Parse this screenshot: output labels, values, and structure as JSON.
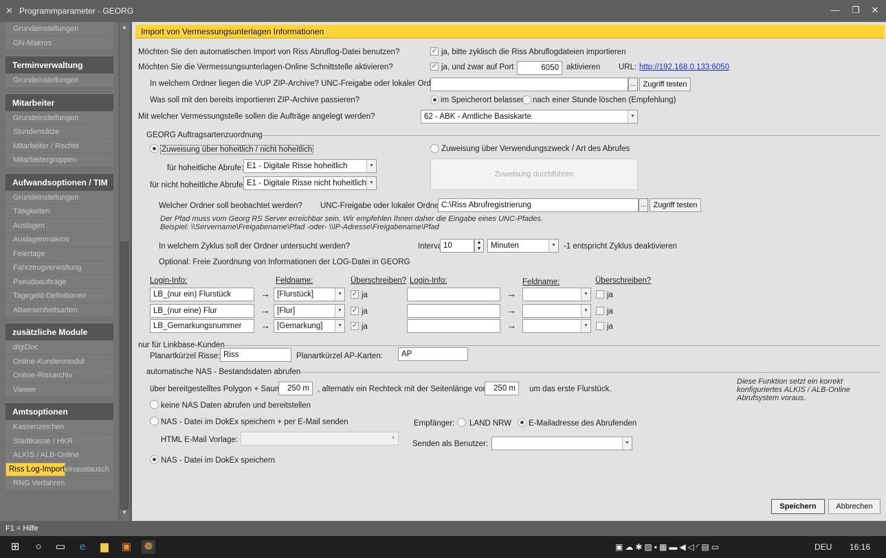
{
  "window": {
    "title": "Programmparameter -   GEORG",
    "status": "F1 = Hilfe"
  },
  "sidebar": {
    "top_items": [
      "Grundeinstellungen",
      "GN-Makros"
    ],
    "groups": [
      {
        "title": "Terminverwaltung",
        "items": [
          "Grundeinstellungen"
        ]
      },
      {
        "title": "Mitarbeiter",
        "items": [
          "Grundeinstellungen",
          "Stundensätze",
          "Mitarbeiter / Rechte",
          "Mitarbeitergruppen"
        ]
      },
      {
        "title": "Aufwandsoptionen / TIM",
        "items": [
          "Grundeinstellungen",
          "Tätigkeiten",
          "Auslagen",
          "Auslagenmakros",
          "Feiertage",
          "Fahrzeugverwaltung",
          "Pseudoaufträge",
          "Tagegeld-Definitionen",
          "Abwesenheitsarten"
        ]
      },
      {
        "title": "zusätzliche Module",
        "items": [
          "digiDoc",
          "Online-Kundenmodul",
          "Online-Rissarchiv",
          "Viewer"
        ]
      },
      {
        "title": "Amtsoptionen",
        "items": [
          "Kassenzeichen",
          "Stadtkasse / HKR",
          "ALKIS / ALB-Online",
          "Riss Log-Import",
          "ALKIS Meilensteinaustausch",
          "RNG Verfahren"
        ]
      }
    ],
    "selected": "Riss Log-Import"
  },
  "header": "Import von Vermessungsunterlagen Informationen",
  "q1": "Möchten Sie den automatischen Import von Riss Abruflog-Datei benutzen?",
  "q1_check": "ja, bitte zyklisch die Riss Abruflogdateien importieren",
  "q2": "Möchten Sie die Vermessungsunterlagen-Online Schnittstelle aktivieren?",
  "q2_check": "ja, und zwar auf Port",
  "port": "6050",
  "aktivieren": "aktivieren",
  "url_label": "URL:",
  "url": "http://192.168.0.133:6050",
  "q3": "In welchem Ordner liegen die VUP ZIP-Archive?  UNC-Freigabe oder lokaler Ordner:",
  "dots": "...",
  "test_btn": "Zugriff testen",
  "q4": "Was soll mit den bereits importieren ZIP-Archive passieren?",
  "opt_keep": "im Speicherort belassen",
  "opt_delete": "nach einer Stunde löschen (Empfehlung)",
  "q5": "Mit welcher Vermessungstelle sollen die Aufträge angelegt werden?",
  "vstelle": "62 - ABK - Amtliche Basiskarte",
  "grp_auftrag": "GEORG Auftragsartenzuordnung",
  "radio_hoheit": "Zuweisung über hoheitlich / nicht hoheitlich",
  "radio_zweck": "Zuweisung über Verwendungszweck / Art des Abrufes",
  "hoheit_label": "für hoheitliche Abrufe:",
  "hoheit_val": "E1 - Digitale Risse hoheitlich",
  "nhoheit_label": "für nicht hoheitliche Abrufe:",
  "nhoheit_val": "E1 - Digitale Risse nicht hoheitlich",
  "zuweisung_btn": "Zuweisung durchführen",
  "q6": "Welcher Ordner soll beobachtet werden?",
  "q6_unc": "UNC-Freigabe oder lokaler Ordner:",
  "folder": "C:\\Riss Abrufregistrierung",
  "hint1": "Der Pfad muss vom Georg RS Server erreichbar sein. Wir empfehlen Ihnen daher die Eingabe eines UNC-Pfades.",
  "hint2": "Beispiel: \\\\Servername\\Freigabename\\Pfad -oder- \\\\IP-Adresse\\Freigabename\\Pfad",
  "q7": "In welchem Zyklus soll der Ordner untersucht werden?",
  "intervall": "Intervall",
  "interval_val": "10",
  "unit": "Minuten",
  "cycle_note": "-1 entspricht Zyklus deaktivieren",
  "optional": "Optional: Freie Zuordnung von Informationen der LOG-Datei in GEORG",
  "col_login": "Login-Info:",
  "col_feld": "Feldname:",
  "col_over": "Überschreiben?",
  "arrow": "→",
  "ja": "ja",
  "rows": [
    {
      "login": "LB_(nur ein) Flurstück",
      "feld": "[Flurstück]"
    },
    {
      "login": "LB_(nur eine) Flur",
      "feld": "[Flur]"
    },
    {
      "login": "LB_Gemarkungsnummer",
      "feld": "[Gemarkung]"
    }
  ],
  "grp_link": "nur für Linkbase-Kunden",
  "risse_label": "Planartkürzel Risse:",
  "risse_val": "Riss",
  "ap_label": "Planartkürzel AP-Karten:",
  "ap_val": "AP",
  "grp_nas": "automatische NAS - Bestandsdaten abrufen",
  "poly_label": "über bereitgestelltes Polygon + Saum",
  "poly_val": "250 m",
  "rect_label": ", alternativ ein Rechteck mit der Seitenlänge von",
  "rect_val": "250 m",
  "rect_tail": "um das erste Flurstück.",
  "nas_note1": "Diese Funktion setzt ein korrekt",
  "nas_note2": "konfiguriertes ALKIS / ALB-Online",
  "nas_note3": "Abrufsystem voraus.",
  "nas_opt1": "keine NAS Daten abrufen und bereitstellen",
  "nas_opt2": "NAS - Datei im DokEx speichern + per E-Mail senden",
  "empf": "Empfänger:",
  "empf1": "LAND NRW",
  "empf2": "E-Mailadresse des Abrufenden",
  "html_vorlage": "HTML E-Mail Vorlage:",
  "senden": "Senden als Benutzer:",
  "nas_opt3": "NAS - Datei im DokEx speichern",
  "save": "Speichern",
  "cancel": "Abbrechen",
  "taskbar": {
    "lang": "DEU",
    "time": "16:16"
  }
}
